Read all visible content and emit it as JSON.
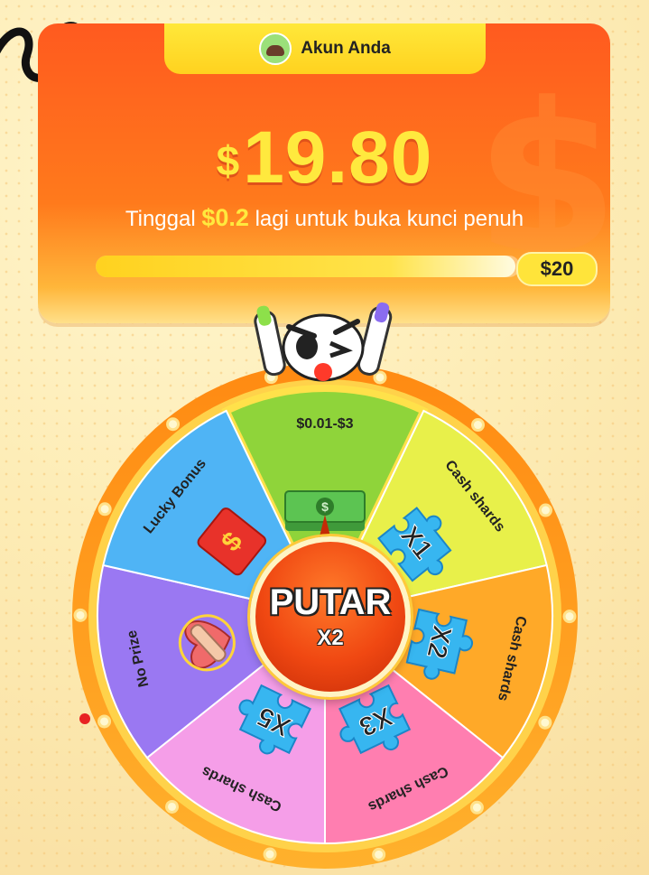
{
  "account": {
    "label": "Akun Anda",
    "avatar_icon": "avatar-icon"
  },
  "balance": {
    "currency": "$",
    "amount": "19.80"
  },
  "unlock": {
    "prefix": "Tinggal",
    "amount": "$0.2",
    "suffix": "lagi untuk buka kunci penuh"
  },
  "progress": {
    "fraction": 0.99,
    "goal_label": "$20"
  },
  "wheel": {
    "segments": [
      {
        "label": "$0.01-$3",
        "color": "#8fd43a",
        "icon": "cash-stack-icon"
      },
      {
        "label": "Cash shards",
        "multiplier": "X1",
        "color": "#e8f04a",
        "icon": "puzzle-icon"
      },
      {
        "label": "Cash shards",
        "multiplier": "X2",
        "color": "#ffa928",
        "icon": "puzzle-icon"
      },
      {
        "label": "Cash shards",
        "multiplier": "X3",
        "color": "#ff7eb0",
        "icon": "puzzle-icon"
      },
      {
        "label": "Cash shards",
        "multiplier": "X5",
        "color": "#f59ee8",
        "icon": "puzzle-icon"
      },
      {
        "label": "No Prize",
        "color": "#9a78f2",
        "icon": "heart-bandage-icon"
      },
      {
        "label": "Lucky Bonus",
        "color": "#4fb4f5",
        "icon": "red-envelope-icon"
      }
    ],
    "spin_button": {
      "label": "PUTAR",
      "multiplier": "X2"
    }
  },
  "colors": {
    "card_orange": "#ff5a1f",
    "accent_yellow": "#ffe93e",
    "rim_orange": "#ff9a1a"
  }
}
